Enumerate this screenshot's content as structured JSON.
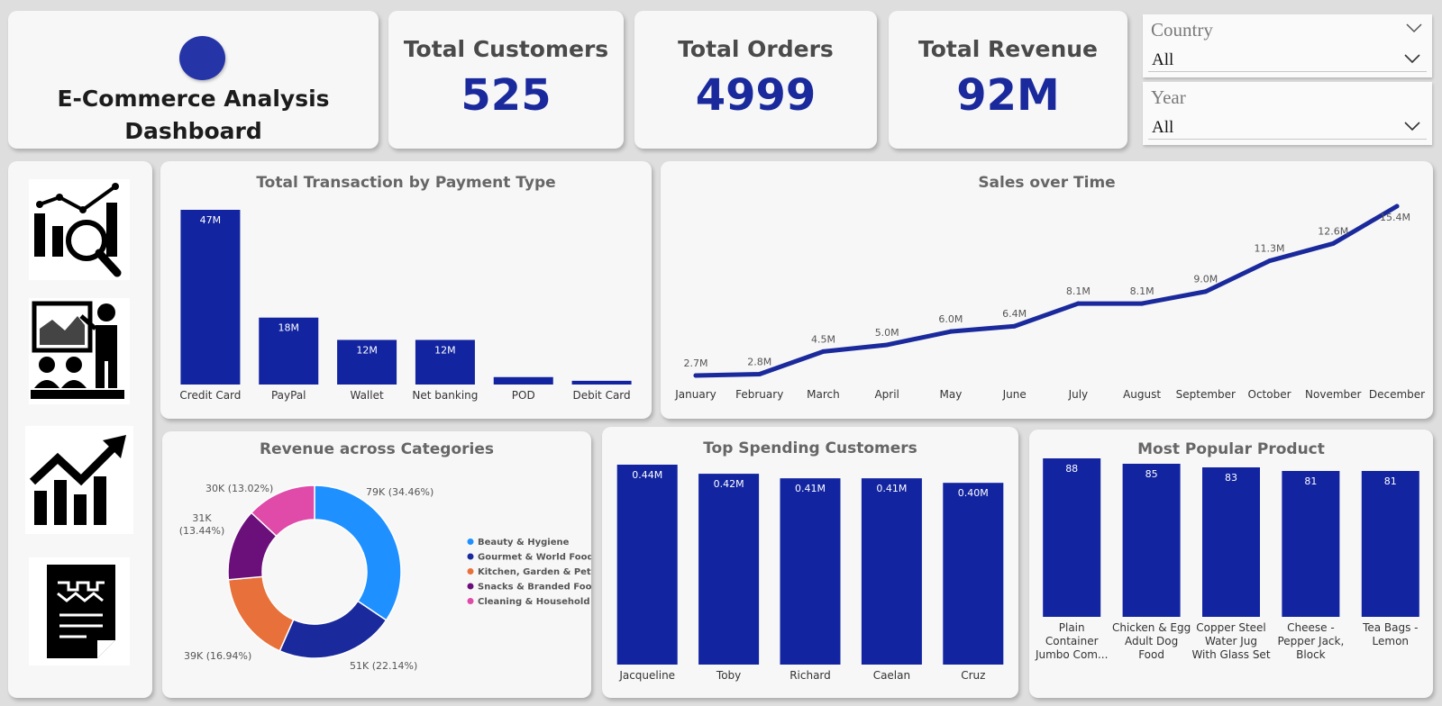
{
  "header": {
    "title_line1": "E-Commerce Analysis",
    "title_line2": "Dashboard"
  },
  "kpis": {
    "customers_label": "Total Customers",
    "customers_value": "525",
    "orders_label": "Total Orders",
    "orders_value": "4999",
    "revenue_label": "Total Revenue",
    "revenue_value": "92M"
  },
  "filters": {
    "country_label": "Country",
    "country_value": "All",
    "year_label": "Year",
    "year_value": "All"
  },
  "nav": {
    "icons": [
      "analytics-magnifier-icon",
      "presentation-icon",
      "growth-chart-icon",
      "report-document-icon"
    ]
  },
  "colors": {
    "bar": "#1224a0",
    "line": "#1a2a9c",
    "accent": "#2535a8",
    "pie": [
      "#1e90ff",
      "#1a2a9c",
      "#e8703a",
      "#6b0f7a",
      "#e04aa8"
    ]
  },
  "chart_data": [
    {
      "type": "bar",
      "title": "Total Transaction by Payment Type",
      "categories": [
        "Credit Card",
        "PayPal",
        "Wallet",
        "Net banking",
        "POD",
        "Debit Card"
      ],
      "values": [
        47,
        18,
        12,
        12,
        2,
        1
      ],
      "labels": [
        "47M",
        "18M",
        "12M",
        "12M",
        "",
        ""
      ]
    },
    {
      "type": "line",
      "title": "Sales over Time",
      "categories": [
        "January",
        "February",
        "March",
        "April",
        "May",
        "June",
        "July",
        "August",
        "September",
        "October",
        "November",
        "December"
      ],
      "values": [
        2.7,
        2.8,
        4.5,
        5.0,
        6.0,
        6.4,
        8.1,
        8.1,
        9.0,
        11.3,
        12.6,
        15.4
      ],
      "labels": [
        "2.7M",
        "2.8M",
        "4.5M",
        "5.0M",
        "6.0M",
        "6.4M",
        "8.1M",
        "8.1M",
        "9.0M",
        "11.3M",
        "12.6M",
        "15.4M"
      ]
    },
    {
      "type": "pie",
      "title": "Revenue across Categories",
      "categories": [
        "Beauty & Hygiene",
        "Gourmet & World Food",
        "Kitchen, Garden & Pets",
        "Snacks & Branded Foods",
        "Cleaning & Household"
      ],
      "values": [
        34.46,
        22.14,
        16.94,
        13.44,
        13.02
      ],
      "labels": [
        "79K (34.46%)",
        "51K (22.14%)",
        "39K (16.94%)",
        "31K (13.44%)",
        "30K (13.02%)"
      ],
      "legend_position": "right"
    },
    {
      "type": "bar",
      "title": "Top Spending Customers",
      "categories": [
        "Jacqueline",
        "Toby",
        "Richard",
        "Caelan",
        "Cruz"
      ],
      "values": [
        0.44,
        0.42,
        0.41,
        0.41,
        0.4
      ],
      "labels": [
        "0.44M",
        "0.42M",
        "0.41M",
        "0.41M",
        "0.40M"
      ]
    },
    {
      "type": "bar",
      "title": "Most Popular Product",
      "categories": [
        "Plain Container Jumbo Com...",
        "Chicken & Egg Adult Dog Food",
        "Copper Steel Water Jug With Glass Set",
        "Cheese - Pepper Jack, Block",
        "Tea Bags - Lemon"
      ],
      "category_lines": [
        [
          "Plain",
          "Container",
          "Jumbo Com..."
        ],
        [
          "Chicken & Egg",
          "Adult Dog",
          "Food"
        ],
        [
          "Copper Steel",
          "Water Jug",
          "With Glass Set"
        ],
        [
          "Cheese -",
          "Pepper Jack,",
          "Block"
        ],
        [
          "Tea Bags -",
          "Lemon"
        ]
      ],
      "values": [
        88,
        85,
        83,
        81,
        81
      ],
      "labels": [
        "88",
        "85",
        "83",
        "81",
        "81"
      ]
    }
  ]
}
